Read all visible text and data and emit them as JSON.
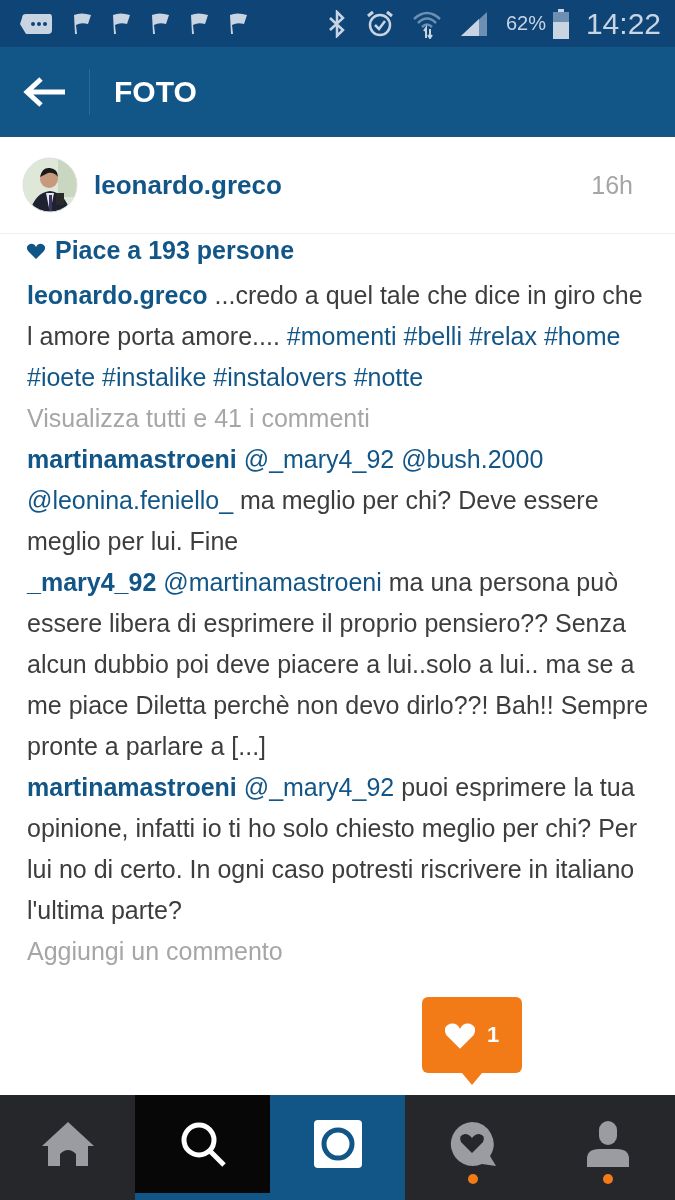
{
  "status_bar": {
    "battery": "62%",
    "time": "14:22"
  },
  "header": {
    "title": "FOTO"
  },
  "post": {
    "user": "leonardo.greco",
    "age": "16h",
    "likes": "Piace a 193 persone",
    "caption": [
      {
        "kind": "user",
        "text": "leonardo.greco"
      },
      {
        "kind": "text",
        "text": "...credo a quel tale che dice in giro che l amore porta amore...."
      },
      {
        "kind": "tag",
        "text": "#momenti"
      },
      {
        "kind": "tag",
        "text": "#belli"
      },
      {
        "kind": "tag",
        "text": "#relax"
      },
      {
        "kind": "tag",
        "text": "#home"
      },
      {
        "kind": "tag",
        "text": "#ioete"
      },
      {
        "kind": "tag",
        "text": "#instalike"
      },
      {
        "kind": "tag",
        "text": "#instalovers"
      },
      {
        "kind": "tag",
        "text": "#notte"
      }
    ],
    "view_all": "Visualizza tutti e 41 i commenti",
    "comments": [
      [
        {
          "kind": "user",
          "text": "martinamastroeni"
        },
        {
          "kind": "tag",
          "text": "@_mary4_92"
        },
        {
          "kind": "tag",
          "text": "@bush.2000"
        },
        {
          "kind": "tag",
          "text": "@leonina.feniello_"
        },
        {
          "kind": "text",
          "text": " ma meglio per chi? Deve essere meglio per lui. Fine"
        }
      ],
      [
        {
          "kind": "user",
          "text": "_mary4_92"
        },
        {
          "kind": "tag",
          "text": "@martinamastroeni"
        },
        {
          "kind": "text",
          "text": "ma una persona può essere libera di esprimere il proprio pensiero?? Senza alcun dubbio poi deve piacere a lui..solo a lui.. ma se a me piace Diletta perchè non devo dirlo??! Bah!! Sempre pronte a parlare a [...]"
        }
      ],
      [
        {
          "kind": "user",
          "text": "martinamastroeni"
        },
        {
          "kind": "tag",
          "text": "@_mary4_92"
        },
        {
          "kind": "text",
          "text": "puoi esprimere la tua opinione, infatti io ti ho solo chiesto meglio per chi? Per lui no di certo. In ogni caso potresti riscrivere in italiano l'ultima parte?"
        }
      ]
    ],
    "add_comment": {
      "placeholder": "Aggiungi un commento"
    }
  },
  "notification": {
    "count": "1"
  },
  "nav": [
    {
      "kind": "home",
      "selected": false,
      "dot": false
    },
    {
      "kind": "search",
      "selected": true,
      "dot": false
    },
    {
      "kind": "camera",
      "selected": false,
      "dot": false
    },
    {
      "kind": "activity",
      "selected": false,
      "dot": true
    },
    {
      "kind": "profile",
      "selected": false,
      "dot": true
    }
  ]
}
